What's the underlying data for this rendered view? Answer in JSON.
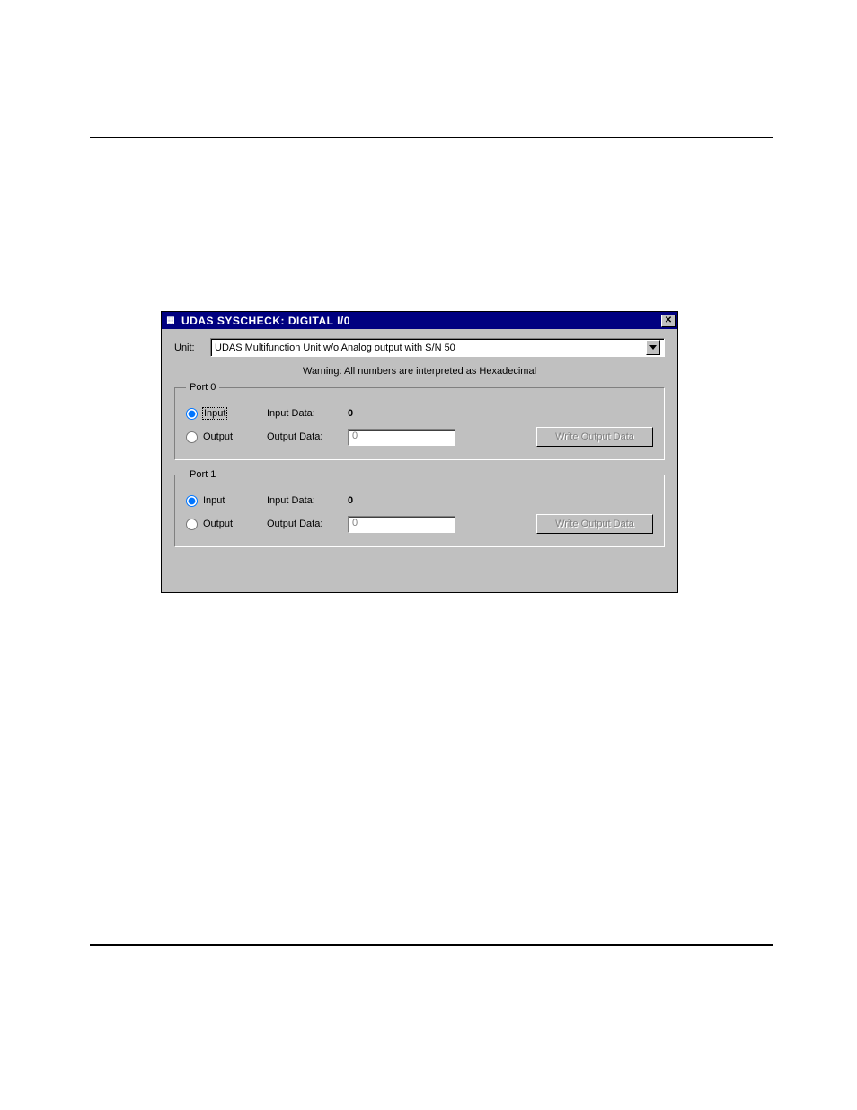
{
  "window": {
    "title": "UDAS SYSCHECK: DIGITAL I/0",
    "close_glyph": "✕",
    "app_icon_glyph": "▦"
  },
  "unit": {
    "label": "Unit:",
    "selected": "UDAS Multifunction Unit w/o Analog output with S/N  50"
  },
  "warning": "Warning: All numbers are interpreted as Hexadecimal",
  "ports": [
    {
      "legend": "Port 0",
      "input_radio_label": "Input",
      "output_radio_label": "Output",
      "input_data_label": "Input Data:",
      "input_data_value": "0",
      "output_data_label": "Output Data:",
      "output_data_value": "0",
      "write_button_label": "Write Output Data",
      "selected": "input",
      "input_focused": true
    },
    {
      "legend": "Port 1",
      "input_radio_label": "Input",
      "output_radio_label": "Output",
      "input_data_label": "Input Data:",
      "input_data_value": "0",
      "output_data_label": "Output Data:",
      "output_data_value": "0",
      "write_button_label": "Write Output Data",
      "selected": "input",
      "input_focused": false
    }
  ]
}
